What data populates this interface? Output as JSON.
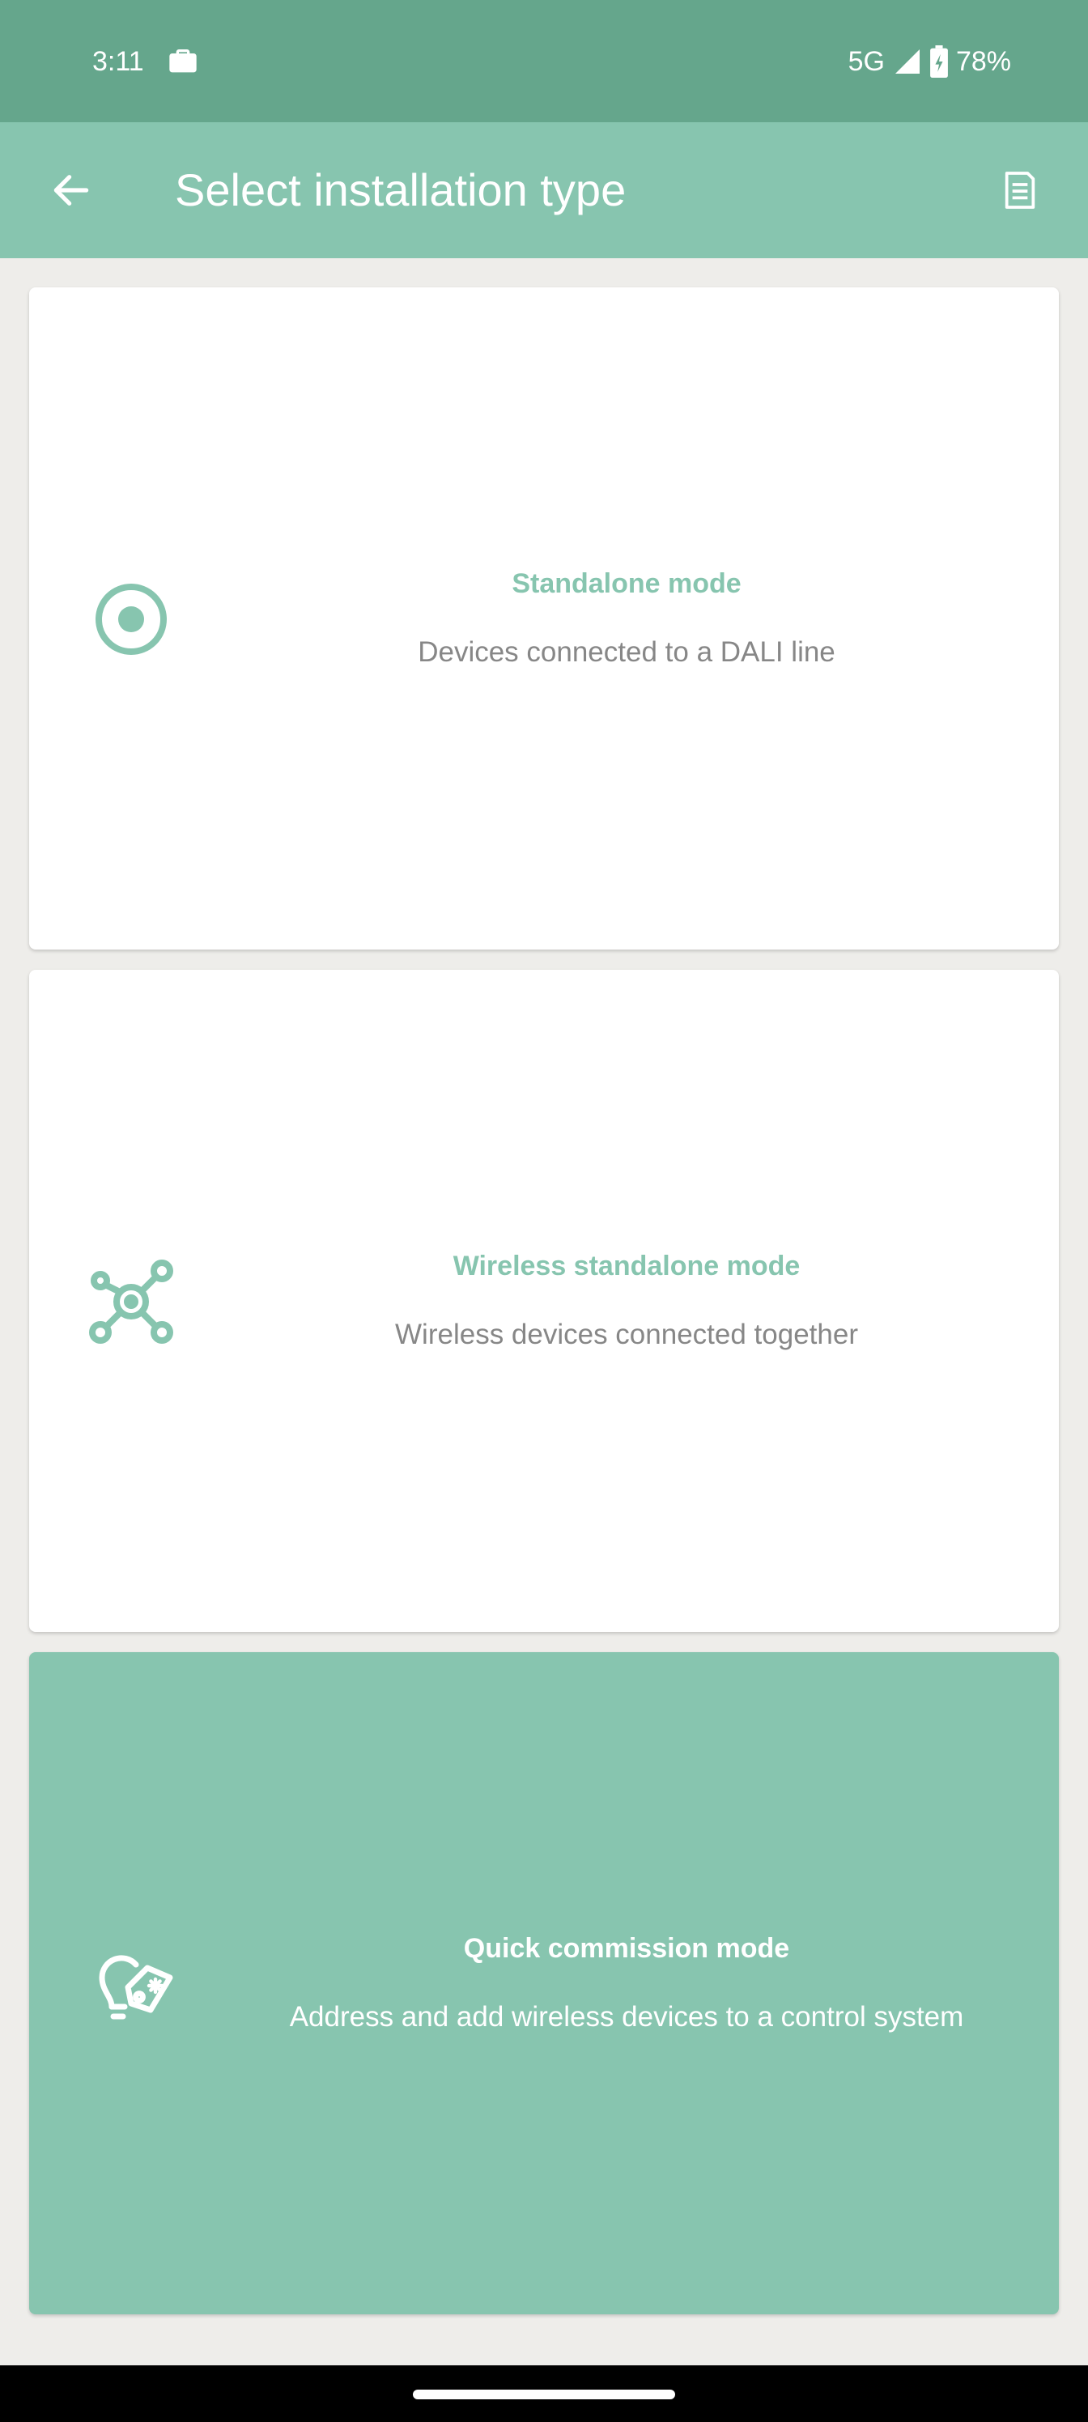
{
  "status_bar": {
    "time": "3:11",
    "network": "5G",
    "battery": "78%",
    "icons": [
      "briefcase-icon",
      "signal-icon",
      "battery-icon"
    ]
  },
  "app_bar": {
    "title": "Select installation type",
    "back_icon": "arrow-back-icon",
    "action_icon": "document-icon"
  },
  "installation_types": [
    {
      "title": "Standalone mode",
      "description": "Devices connected to a DALI line",
      "icon": "radio-target-icon",
      "selected": false
    },
    {
      "title": "Wireless standalone mode",
      "description": "Wireless devices connected together",
      "icon": "network-nodes-icon",
      "selected": false
    },
    {
      "title": "Quick commission mode",
      "description": "Address and add wireless devices to a control system",
      "icon": "bulb-tag-icon",
      "selected": true
    }
  ],
  "colors": {
    "status_bar": "#65a68c",
    "app_bar": "#87c5af",
    "accent": "#87c5af",
    "background": "#eeedea",
    "card": "#ffffff",
    "description_text": "#878787"
  }
}
